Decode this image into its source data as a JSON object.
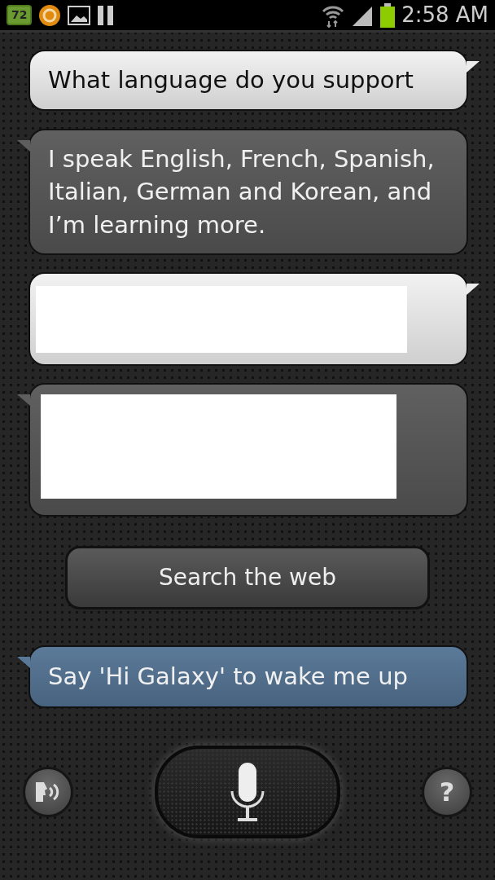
{
  "status_bar": {
    "battery_badge": "72",
    "time": "2:58 AM"
  },
  "messages": [
    {
      "kind": "user",
      "text": "What language do you support",
      "redacted": false
    },
    {
      "kind": "assistant",
      "text": "I speak English, French, Spanish, Italian, German and Korean, and I’m learning more.",
      "redacted": false
    },
    {
      "kind": "user",
      "redacted": true
    },
    {
      "kind": "assistant",
      "redacted": true
    }
  ],
  "search_button": "Search the web",
  "hint": {
    "kind": "hint",
    "text": "Say 'Hi Galaxy' to wake me up"
  },
  "help_button": "?"
}
